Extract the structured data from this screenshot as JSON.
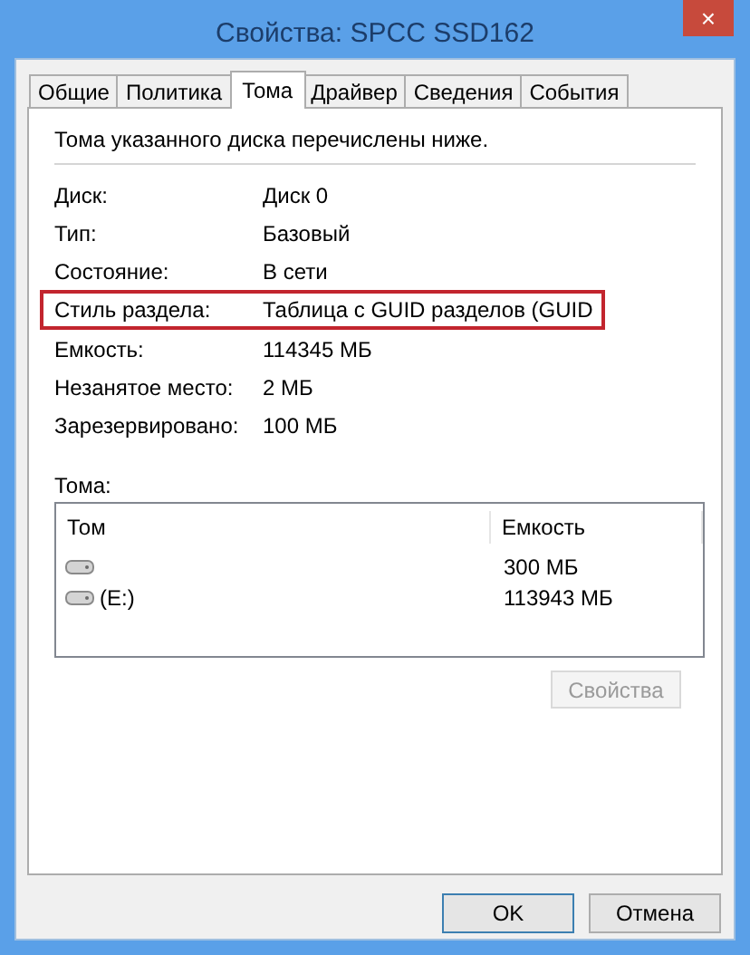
{
  "window": {
    "title": "Свойства: SPCC SSD162",
    "close": "×"
  },
  "tabs": [
    {
      "label": "Общие",
      "selected": false
    },
    {
      "label": "Политика",
      "selected": false
    },
    {
      "label": "Тома",
      "selected": true
    },
    {
      "label": "Драйвер",
      "selected": false
    },
    {
      "label": "Сведения",
      "selected": false
    },
    {
      "label": "События",
      "selected": false
    }
  ],
  "intro": "Тома указанного диска перечислены ниже.",
  "properties": [
    {
      "label": "Диск:",
      "value": "Диск 0",
      "highlighted": false
    },
    {
      "label": "Тип:",
      "value": "Базовый",
      "highlighted": false
    },
    {
      "label": "Состояние:",
      "value": "В сети",
      "highlighted": false
    },
    {
      "label": "Стиль раздела:",
      "value": "Таблица с GUID разделов (GUID",
      "highlighted": true
    },
    {
      "label": "Емкость:",
      "value": "114345 МБ",
      "highlighted": false
    },
    {
      "label": "Незанятое место:",
      "value": "2 МБ",
      "highlighted": false
    },
    {
      "label": "Зарезервировано:",
      "value": "100 МБ",
      "highlighted": false
    }
  ],
  "volumes_label": "Тома:",
  "volumes": {
    "columns": [
      "Том",
      "Емкость"
    ],
    "rows": [
      {
        "name": "",
        "capacity": "300 МБ"
      },
      {
        "name": "(E:)",
        "capacity": "113943 МБ"
      }
    ]
  },
  "properties_button": {
    "label": "Свойства",
    "disabled": true
  },
  "buttons": [
    {
      "label": "OK",
      "default": true
    },
    {
      "label": "Отмена",
      "default": false
    }
  ]
}
